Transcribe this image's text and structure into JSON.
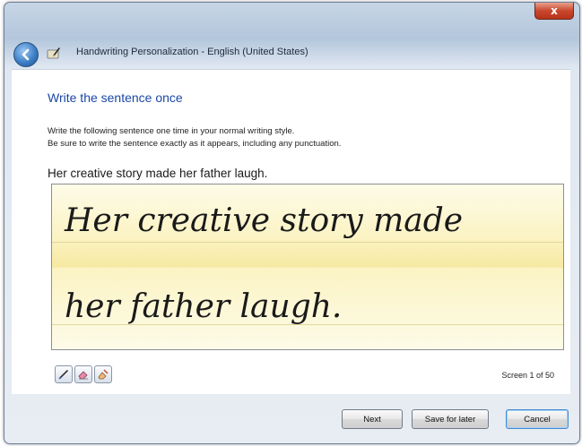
{
  "window": {
    "title": "Handwriting Personalization - English (United States)",
    "close_label": "x"
  },
  "page": {
    "heading": "Write the sentence once",
    "instruction_1": "Write the following sentence one time in your normal writing style.",
    "instruction_2": "Be sure to write the sentence exactly as it appears, including any punctuation.",
    "sentence": "Her creative story made her father laugh."
  },
  "ink": {
    "line_1": "Her creative story made",
    "line_2": "her father laugh."
  },
  "tools": [
    {
      "name": "pen-icon"
    },
    {
      "name": "eraser-icon"
    },
    {
      "name": "clear-icon"
    }
  ],
  "status": {
    "screen_count": "Screen 1 of 50"
  },
  "buttons": {
    "next": "Next",
    "save_for_later": "Save for later",
    "cancel": "Cancel"
  },
  "colors": {
    "heading": "#1b47a7",
    "ink": "#1a1a1a",
    "writing_area": "#fbf3c3"
  }
}
